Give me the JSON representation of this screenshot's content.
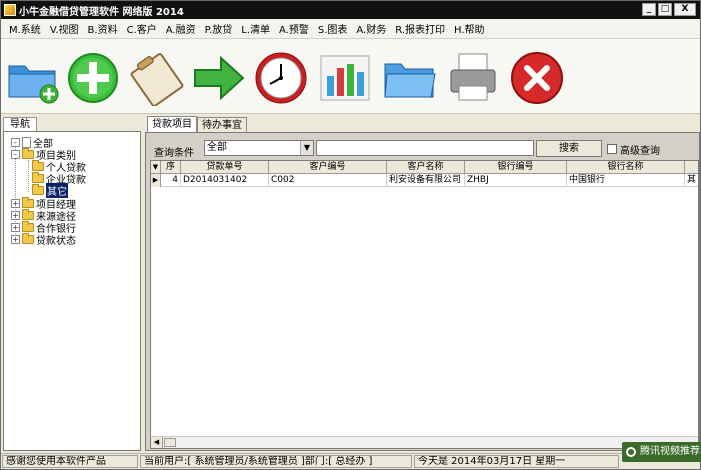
{
  "window": {
    "title": "小牛金融借贷管理软件 网络版 2014",
    "buttons": {
      "minimize": "_",
      "maximize": "□",
      "close": "X"
    }
  },
  "menu": [
    "M.系统",
    "V.视图",
    "B.资料",
    "C.客户",
    "A.融资",
    "P.放贷",
    "L.清单",
    "A.预警",
    "S.图表",
    "A.财务",
    "R.报表打印",
    "H.帮助"
  ],
  "toolbar": {
    "icons": [
      "add-folder-icon",
      "plus-circle-icon",
      "clipboard-icon",
      "forward-arrow-icon",
      "alarm-clock-icon",
      "bar-chart-icon",
      "open-folder-icon",
      "printer-icon",
      "close-circle-icon"
    ]
  },
  "nav": {
    "tab_label": "导航",
    "tree": {
      "root": "全部",
      "project_type": "项目类别",
      "personal_loan": "个人贷款",
      "business_loan": "企业贷款",
      "other": "其它",
      "project_manager": "项目经理",
      "source": "来源途径",
      "partner_bank": "合作银行",
      "loan_status": "贷款状态"
    }
  },
  "tabs": [
    "贷款项目",
    "待办事宜"
  ],
  "query": {
    "label": "查询条件",
    "select_value": "全部",
    "search_value": "",
    "search_button": "搜索",
    "advanced_label": "高级查询",
    "advanced_checked": false
  },
  "grid": {
    "columns": [
      "序",
      "贷款单号",
      "客户编号",
      "客户名称",
      "银行编号",
      "银行名称",
      ""
    ],
    "rows": [
      [
        "4",
        "D2014031402",
        "C002",
        "利安设备有限公司",
        "ZHBJ",
        "中国银行",
        "其"
      ]
    ]
  },
  "status": {
    "message": "感谢您使用本软件产品",
    "user": "当前用户:[ 系统管理员/系统管理员 ]部门:[ 总经办 ]",
    "date": "今天是 2014年03月17日  星期一",
    "tencent": "腾讯视频推荐"
  },
  "colors": {
    "titlebar": "#101010",
    "selection": "#0a246a",
    "tencent_bg": "#3a6b2a"
  }
}
